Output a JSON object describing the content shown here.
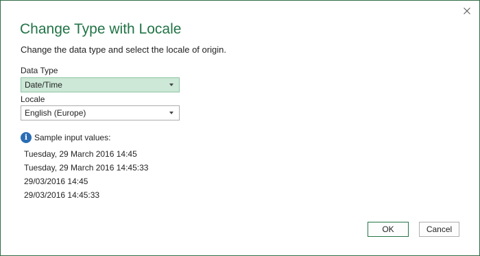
{
  "dialog": {
    "title": "Change Type with Locale",
    "subtitle": "Change the data type and select the locale of origin.",
    "close_icon": "close-icon"
  },
  "data_type": {
    "label": "Data Type",
    "value": "Date/Time"
  },
  "locale": {
    "label": "Locale",
    "value": "English (Europe)"
  },
  "samples": {
    "icon": "info-icon",
    "heading": "Sample input values:",
    "items": [
      "Tuesday, 29 March 2016 14:45",
      "Tuesday, 29 March 2016 14:45:33",
      "29/03/2016 14:45",
      "29/03/2016 14:45:33"
    ]
  },
  "buttons": {
    "ok_label": "OK",
    "cancel_label": "Cancel"
  },
  "colors": {
    "accent": "#217346",
    "selected_field_bg": "#cde8d7",
    "info_icon": "#2a6db5"
  }
}
